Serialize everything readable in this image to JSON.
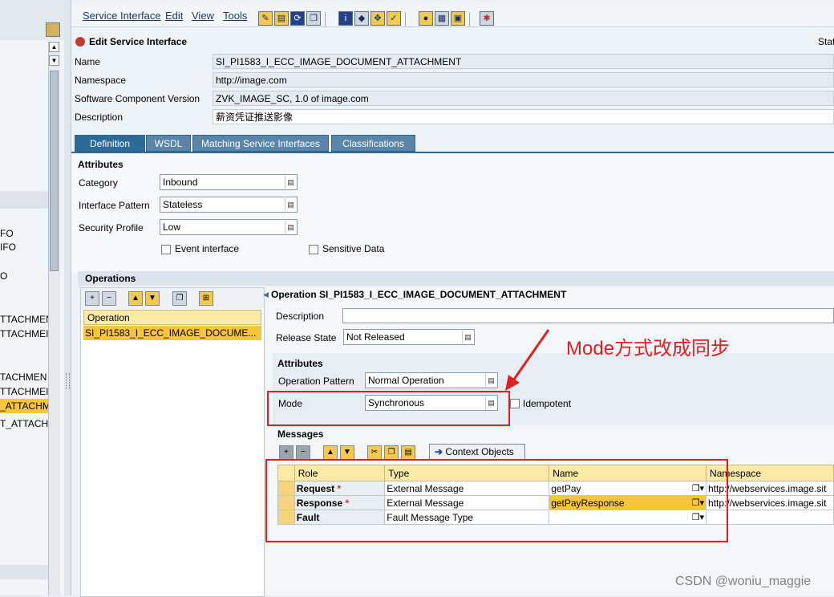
{
  "menu": [
    "Service Interface",
    "Edit",
    "View",
    "Tools"
  ],
  "header": {
    "title": "Edit Service Interface",
    "status_label": "Stat"
  },
  "fields": {
    "name_label": "Name",
    "name": "SI_PI1583_I_ECC_IMAGE_DOCUMENT_ATTACHMENT",
    "namespace_label": "Namespace",
    "namespace": "http://image.com",
    "swcv_label": "Software Component Version",
    "swcv": "ZVK_IMAGE_SC, 1.0 of image.com",
    "description_label": "Description",
    "description": "薪资凭证推送影像"
  },
  "tabs": [
    "Definition",
    "WSDL",
    "Matching Service Interfaces",
    "Classifications"
  ],
  "attributes": {
    "title": "Attributes",
    "category_label": "Category",
    "category": "Inbound",
    "pattern_label": "Interface Pattern",
    "pattern": "Stateless",
    "security_label": "Security Profile",
    "security": "Low",
    "event_label": "Event interface",
    "sensitive_label": "Sensitive Data"
  },
  "operations": {
    "title": "Operations",
    "col": "Operation",
    "row": "SI_PI1583_I_ECC_IMAGE_DOCUME..."
  },
  "operation_detail": {
    "title": "Operation SI_PI1583_I_ECC_IMAGE_DOCUMENT_ATTACHMENT",
    "description_label": "Description",
    "release_label": "Release State",
    "release": "Not Released",
    "attributes_title": "Attributes",
    "op_pattern_label": "Operation Pattern",
    "op_pattern": "Normal Operation",
    "mode_label": "Mode",
    "mode": "Synchronous",
    "idempotent_label": "Idempotent",
    "messages_title": "Messages",
    "context_btn": "Context Objects"
  },
  "messages": {
    "headers": [
      "Role",
      "Type",
      "Name",
      "Namespace"
    ],
    "rows": [
      {
        "role": "Request",
        "required": "*",
        "type": "External Message",
        "name": "getPay",
        "ns": "http://webservices.image.sit"
      },
      {
        "role": "Response",
        "required": "*",
        "type": "External Message",
        "name": "getPayResponse",
        "ns": "http://webservices.image.sit"
      },
      {
        "role": "Fault",
        "required": "",
        "type": "Fault Message Type",
        "name": "",
        "ns": ""
      }
    ]
  },
  "annotation": "Mode方式改成同步",
  "sidebar_rows": [
    "FO",
    "IFO",
    "O",
    "TTACHMEN",
    "TTACHMEI",
    "TACHMEN",
    "TTACHMEI",
    "_ATTACHM",
    "T_ATTACH"
  ],
  "watermark": "CSDN @woniu_maggie",
  "colors": {
    "accent": "#2e6a96",
    "highlight": "#f7c43e",
    "annotation": "#e02020"
  }
}
